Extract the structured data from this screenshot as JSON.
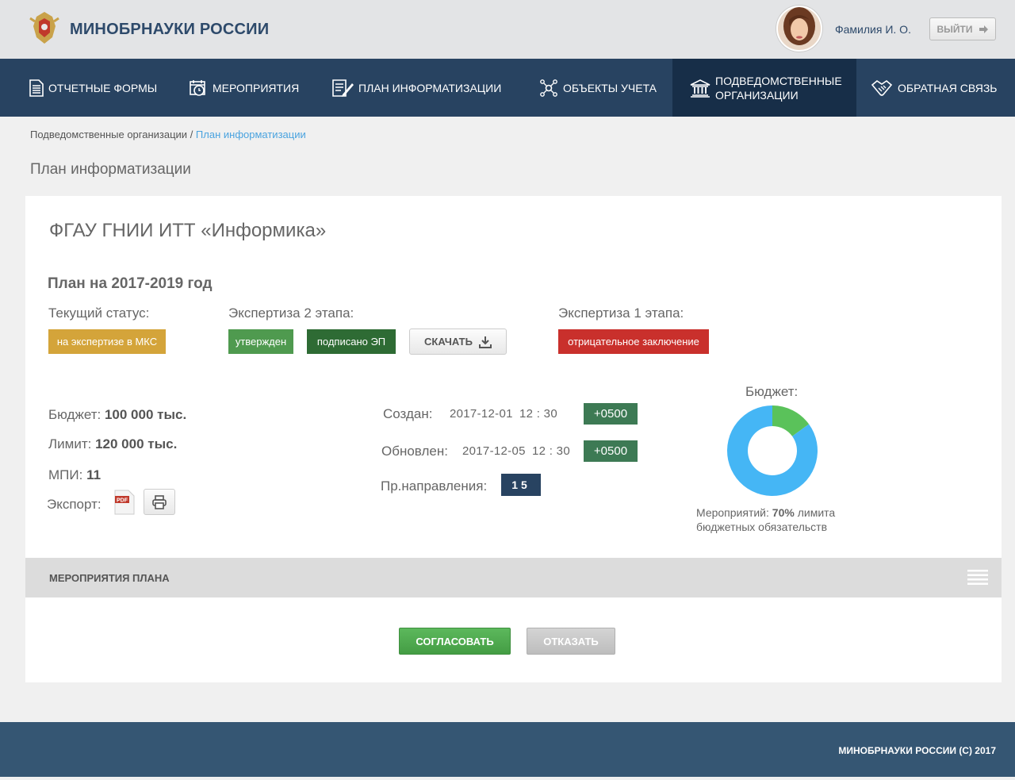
{
  "header": {
    "logo_text": "МИНОБРНАУКИ РОССИИ",
    "user_name": "Фамилия И. О.",
    "logout_label": "ВЫЙТИ"
  },
  "nav": {
    "items": [
      {
        "label": "ОТЧЕТНЫЕ ФОРМЫ",
        "icon": "document-list-icon"
      },
      {
        "label": "МЕРОПРИЯТИЯ",
        "icon": "calendar-clock-icon"
      },
      {
        "label": "ПЛАН ИНФОРМАТИЗАЦИИ",
        "icon": "plan-edit-icon"
      },
      {
        "label": "ОБЪЕКТЫ УЧЕТА",
        "icon": "network-nodes-icon"
      },
      {
        "label_line1": "ПОДВЕДОМСТВЕННЫЕ",
        "label_line2": "ОРГАНИЗАЦИИ",
        "icon": "institution-icon",
        "active": true
      },
      {
        "label": "ОБРАТНАЯ СВЯЗЬ",
        "icon": "handshake-icon"
      }
    ]
  },
  "breadcrumb": {
    "parent": "Подведомственные организации",
    "separator": " / ",
    "current": "План информатизации"
  },
  "page_title": "План информатизации",
  "card": {
    "org_title": "ФГАУ ГНИИ ИТТ «Информика»",
    "plan_title": "План на 2017-2019 год",
    "current_status": {
      "label": "Текущий статус:",
      "badge": "на экспертизе в МКС",
      "badge_color": "#d4a43a"
    },
    "expertise_2": {
      "label": "Экспертиза 2 этапа:",
      "badge_approved": "утвержден",
      "badge_approved_color": "#4f9a4f",
      "badge_signed": "подписано ЭП",
      "badge_signed_color": "#2e6b34",
      "download_label": "СКАЧАТЬ"
    },
    "expertise_1": {
      "label": "Экспертиза 1 этапа:",
      "badge": "отрицательное заключение",
      "badge_color": "#c9302c"
    },
    "budget": {
      "label": "Бюджет:",
      "value": "100 000 тыс."
    },
    "limit": {
      "label": "Лимит:",
      "value": "120 000 тыс."
    },
    "mpi": {
      "label": "МПИ:",
      "value": "11"
    },
    "export": {
      "label": "Экспорт:",
      "pdf_text": "PDF"
    },
    "created": {
      "label": "Создан:",
      "date": "2017-12-01",
      "time": "12 : 30",
      "tz": "+0500"
    },
    "updated": {
      "label": "Обновлен:",
      "date": "2017-12-05",
      "time": "12 : 30",
      "tz": "+0500"
    },
    "directions": {
      "label": "Пр.направления:",
      "value": "15"
    },
    "budget_chart": {
      "title": "Бюджет:",
      "caption_prefix": "Мероприятий:",
      "caption_value": "70%",
      "caption_suffix": "лимита",
      "caption_line2": "бюджетных обязательств",
      "colors": {
        "main": "#45b6f5",
        "accent": "#5ac25a"
      }
    },
    "events": {
      "title": "МЕРОПРИЯТИЯ ПЛАНА"
    },
    "actions": {
      "approve": "СОГЛАСОВАТЬ",
      "reject": "ОТКАЗАТЬ"
    }
  },
  "chart_data": {
    "type": "pie",
    "categories": [
      "",
      ""
    ],
    "values": [
      85,
      15
    ]
  },
  "footer": {
    "text": "МИНОБРНАУКИ РОССИИ  (C) 2017"
  }
}
